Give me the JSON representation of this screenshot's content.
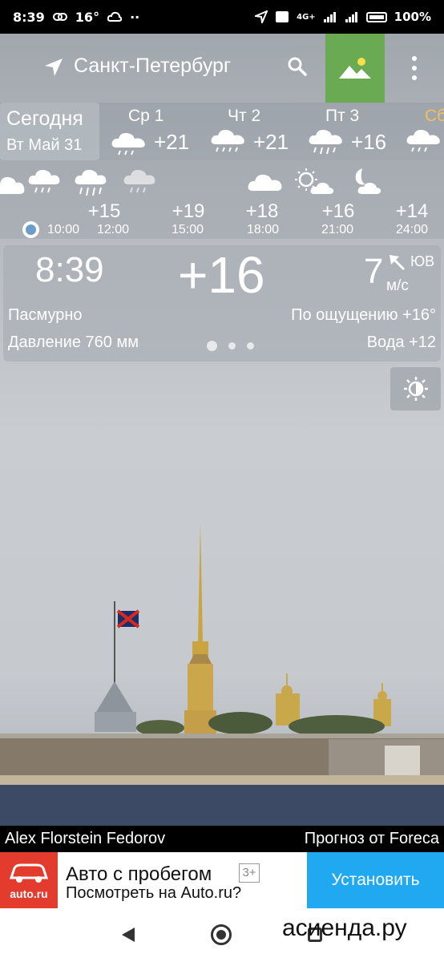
{
  "status_bar": {
    "time": "8:39",
    "temp_indicator": "16°",
    "dots": "··",
    "network": "4G+",
    "battery": "100%"
  },
  "toolbar": {
    "city": "Санкт-Петербург"
  },
  "days": {
    "today_label": "Сегодня",
    "today_date": "Вт Май 31",
    "items": [
      {
        "name": "Ср 1",
        "temp": "+21"
      },
      {
        "name": "Чт 2",
        "temp": "+21"
      },
      {
        "name": "Пт 3",
        "temp": "+16"
      },
      {
        "name": "Сб",
        "temp": ""
      }
    ]
  },
  "hourly": {
    "temps": [
      "+15",
      "+19",
      "+18",
      "+16",
      "+14"
    ],
    "times": [
      "10:00",
      "12:00",
      "15:00",
      "18:00",
      "21:00",
      "24:00"
    ]
  },
  "current": {
    "time": "8:39",
    "temp": "+16",
    "wind_speed": "7",
    "wind_unit": "м/с",
    "wind_dir": "ЮВ",
    "condition": "Пасмурно",
    "feels_like": "По ощущению +16°",
    "pressure": "Давление 760 мм",
    "water": "Вода +12"
  },
  "credits": {
    "author": "Alex Florstein Fedorov",
    "source": "Прогноз от Foreca"
  },
  "ad": {
    "logo_text": "auto.ru",
    "title": "Авто с пробегом",
    "badge": "3+",
    "subtitle": "Посмотреть на Auto.ru?",
    "install": "Установить"
  },
  "watermark": "асиенда.ру",
  "colors": {
    "bg_button": "#6aaa52",
    "ad_logo": "#e33b2e",
    "install": "#20a8f0",
    "sat_day": "#f5c05a"
  }
}
